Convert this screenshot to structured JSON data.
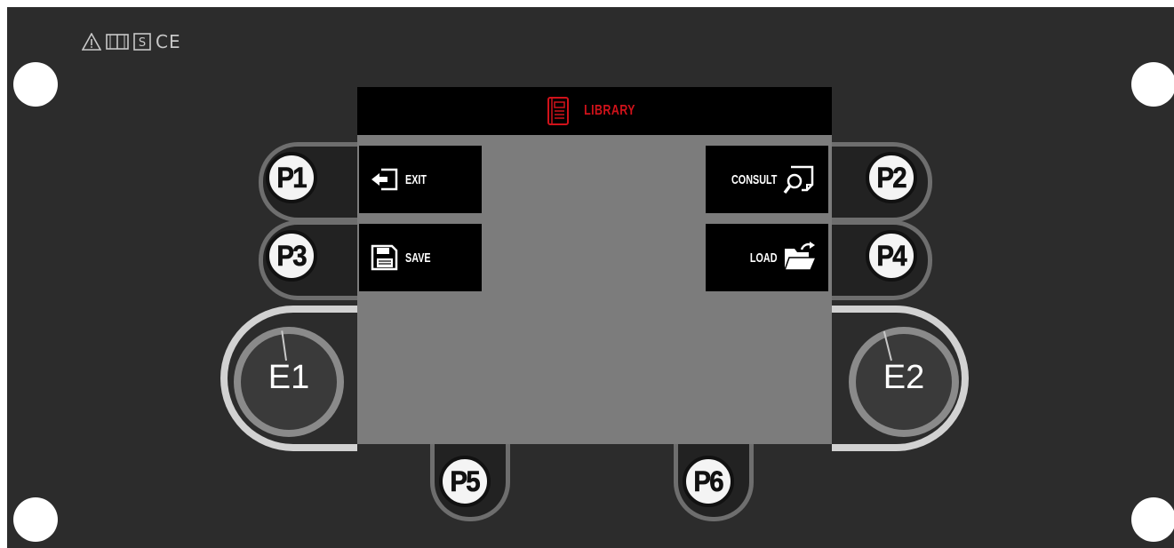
{
  "panel": {
    "compliance_marks": [
      "warning-triangle-icon",
      "manual-book-icon",
      "s-mark-icon",
      "CE"
    ],
    "colors": {
      "panel": "#2c2c2c",
      "screen": "#7c7c7c",
      "accent": "#d0121a",
      "softkey": "#000000"
    }
  },
  "screen": {
    "title": "LIBRARY",
    "title_icon": "library-book-icon",
    "softkeys": {
      "p1": {
        "label": "EXIT",
        "icon": "exit-door-icon"
      },
      "p2": {
        "label": "CONSULT",
        "icon": "search-file-icon"
      },
      "p3": {
        "label": "SAVE",
        "icon": "floppy-disk-icon"
      },
      "p4": {
        "label": "LOAD",
        "icon": "open-folder-icon"
      }
    }
  },
  "buttons": {
    "p1": "P1",
    "p2": "P2",
    "p3": "P3",
    "p4": "P4",
    "p5": "P5",
    "p6": "P6"
  },
  "encoders": {
    "e1": "E1",
    "e2": "E2"
  }
}
